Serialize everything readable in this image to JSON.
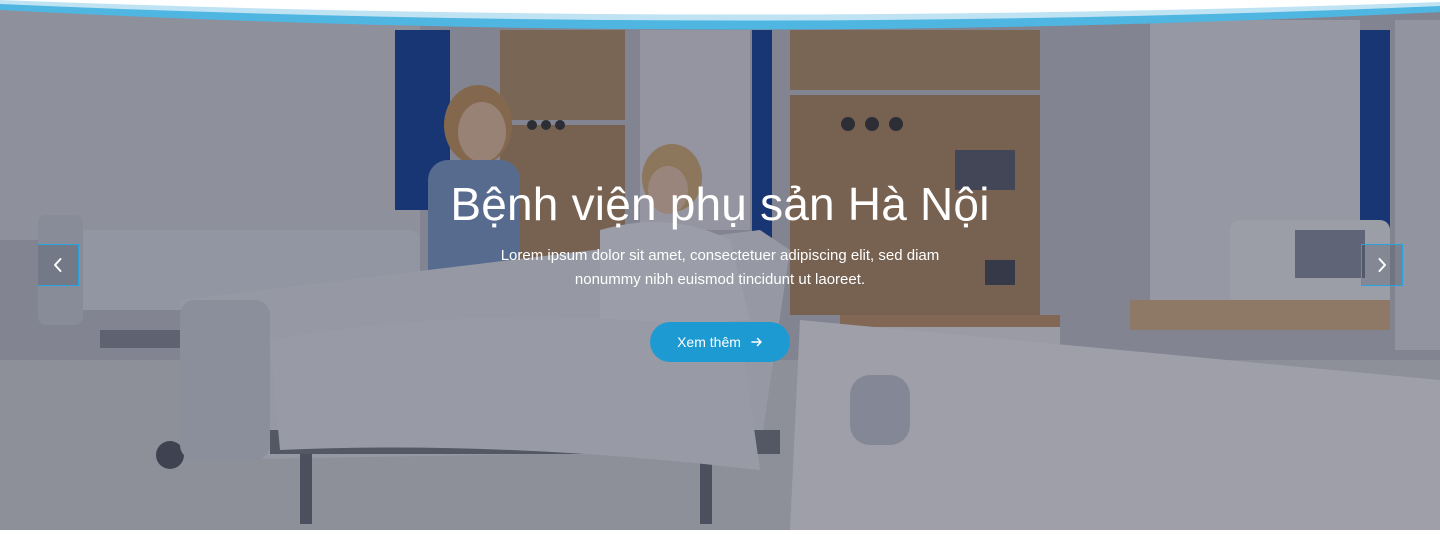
{
  "slider": {
    "title": "Bệnh viện phụ sản Hà Nội",
    "description": "Lorem ipsum dolor sit amet, consectetuer adipiscing elit, sed diam nonummy nibh euismod tincidunt ut laoreet.",
    "cta_label": "Xem thêm",
    "cta_icon": "arrow-right-icon",
    "prev_icon": "chevron-left-icon",
    "next_icon": "chevron-right-icon"
  },
  "colors": {
    "accent": "#1e9ad3",
    "nav_border": "#29a3dd",
    "wave": "#4fb6e2"
  }
}
